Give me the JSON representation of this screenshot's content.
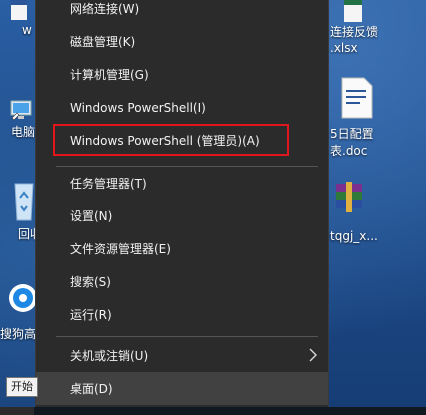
{
  "desktop": {
    "icons": [
      {
        "label": "w"
      },
      {
        "label": "电脑"
      },
      {
        "label": "回收"
      },
      {
        "label": "搜狗高"
      },
      {
        "label": "连接反馈"
      },
      {
        "label": ".xlsx"
      },
      {
        "label": "5日配置"
      },
      {
        "label": "表.doc"
      },
      {
        "label": "tqgj_x..."
      }
    ]
  },
  "menu": {
    "items": [
      {
        "label": "网络连接(W)"
      },
      {
        "label": "磁盘管理(K)"
      },
      {
        "label": "计算机管理(G)"
      },
      {
        "label": "Windows PowerShell(I)"
      },
      {
        "label": "Windows PowerShell (管理员)(A)"
      },
      {
        "label": "任务管理器(T)"
      },
      {
        "label": "设置(N)"
      },
      {
        "label": "文件资源管理器(E)"
      },
      {
        "label": "搜索(S)"
      },
      {
        "label": "运行(R)"
      },
      {
        "label": "关机或注销(U)"
      },
      {
        "label": "桌面(D)"
      }
    ]
  },
  "tooltip": {
    "text": "开始"
  },
  "colors": {
    "menu_bg": "#2b2b2b",
    "highlight_border": "#e0161c",
    "hover_bg": "#414141"
  }
}
